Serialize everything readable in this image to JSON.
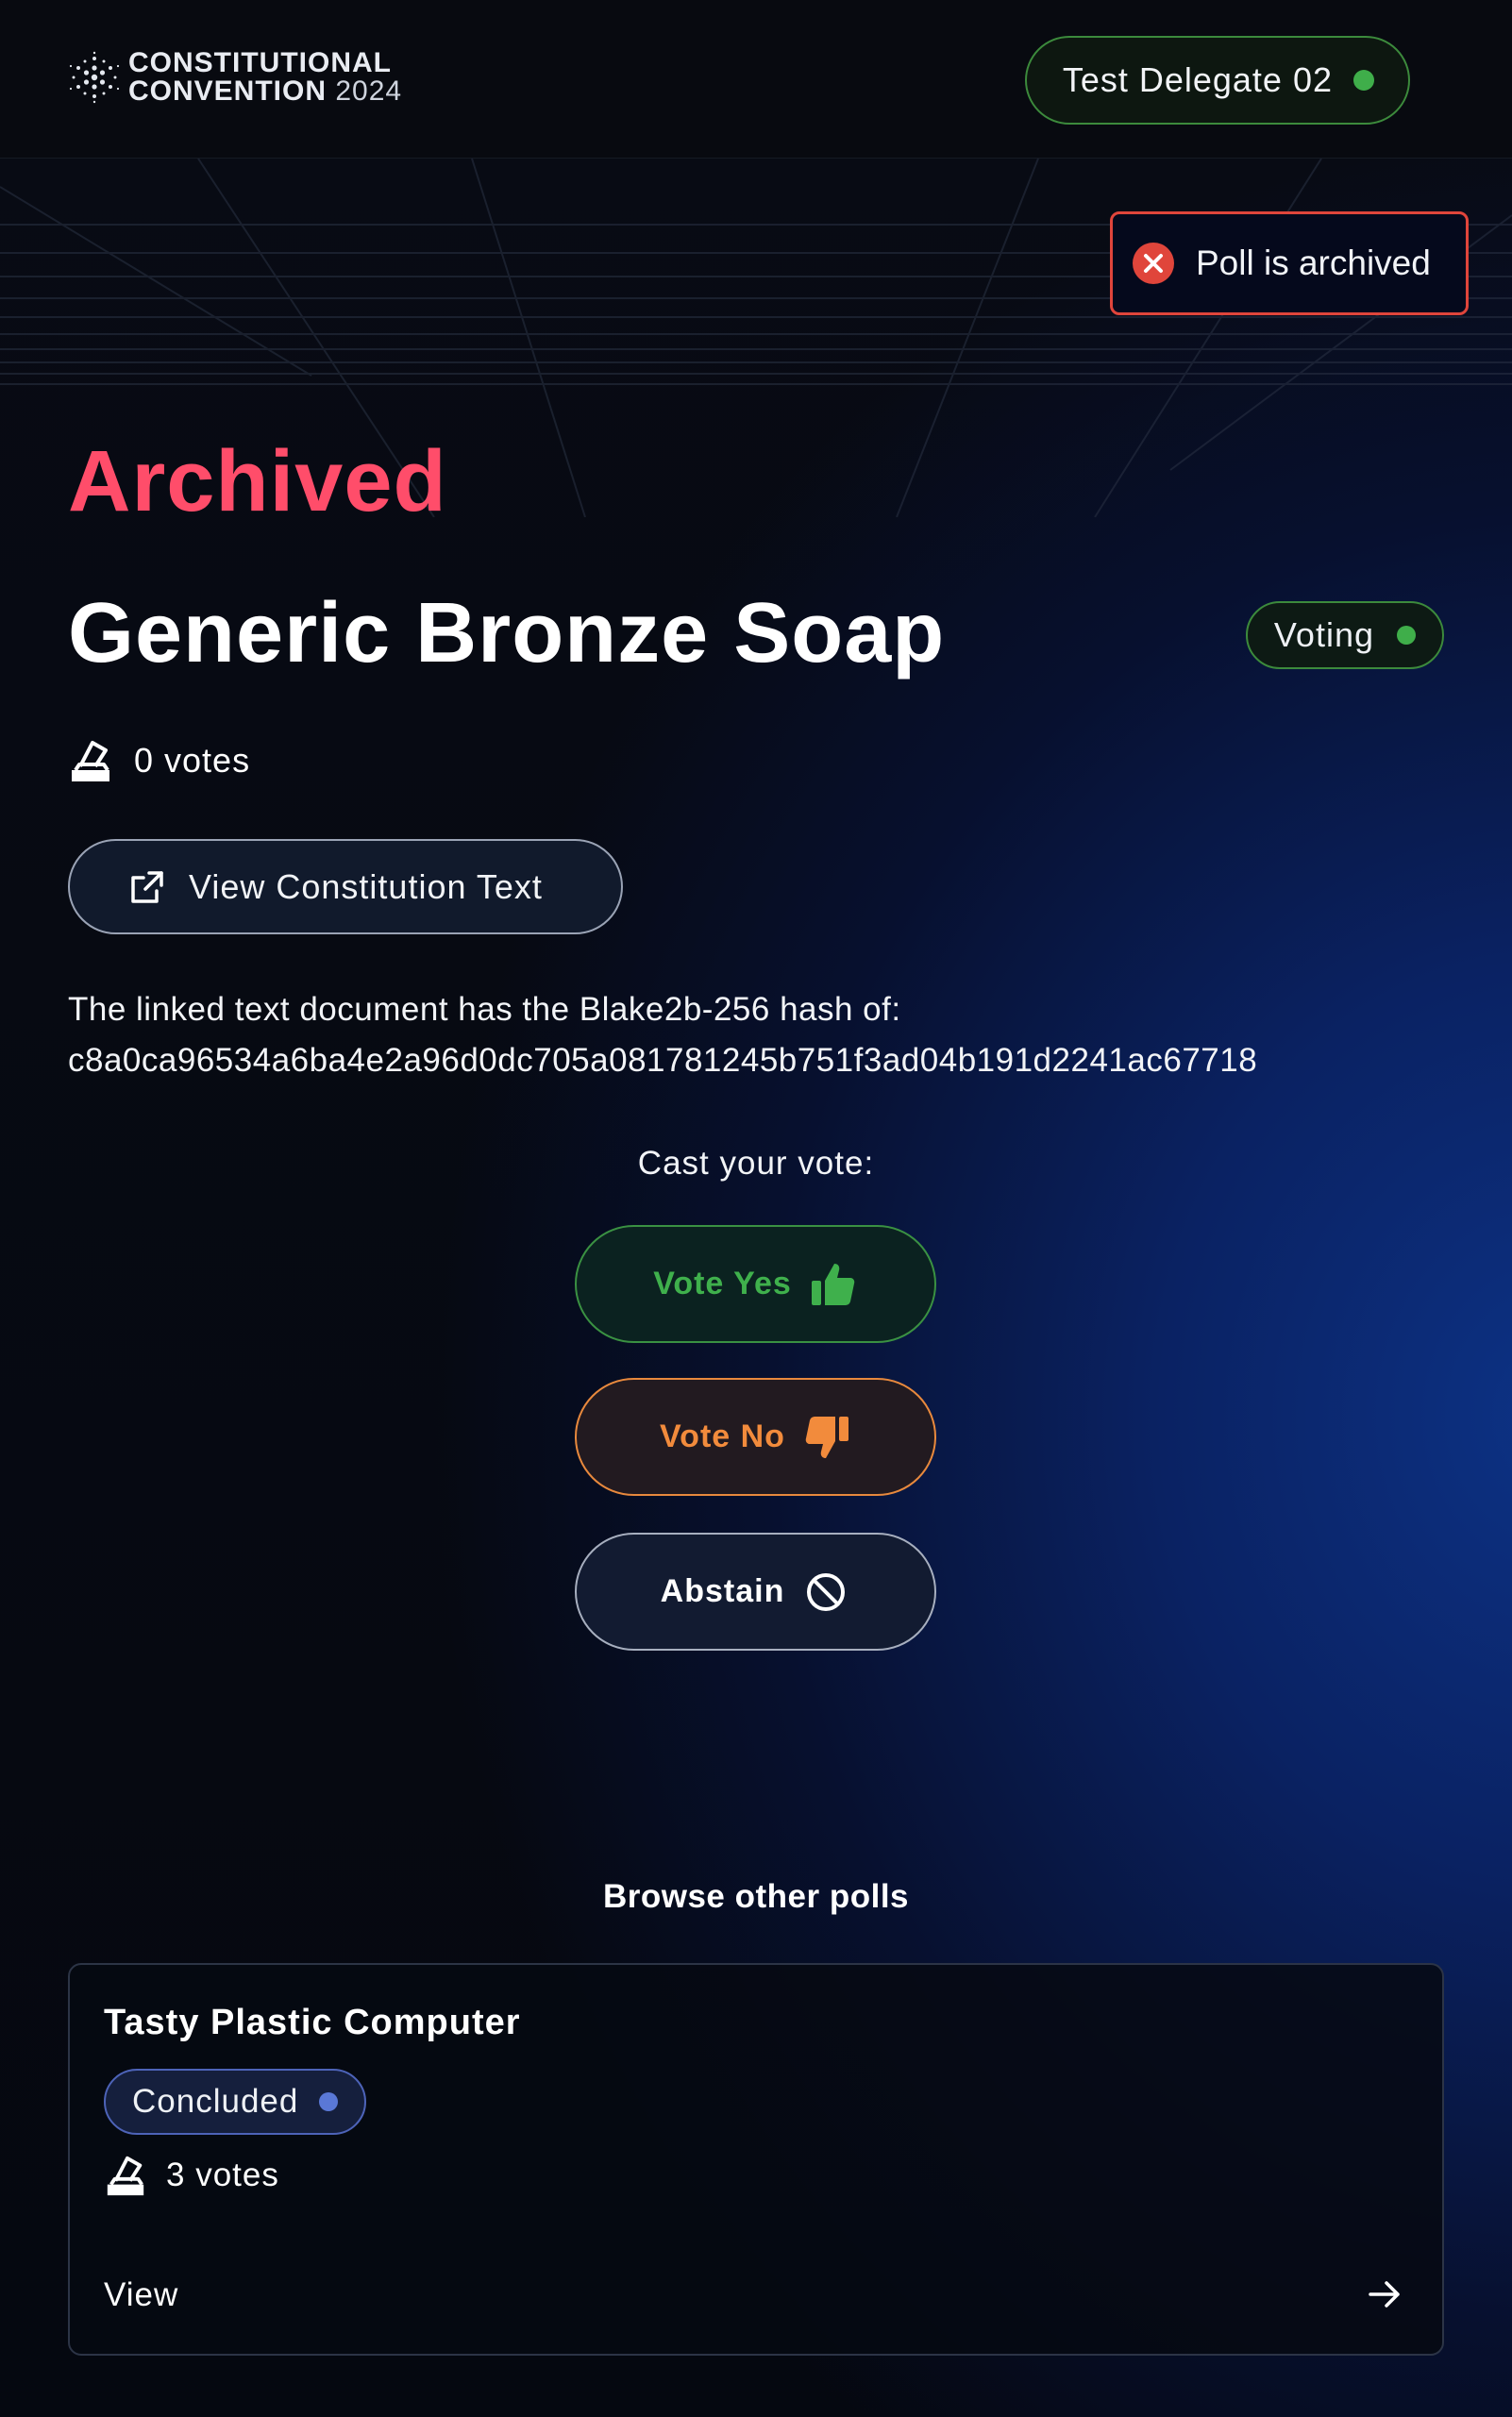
{
  "header": {
    "logo_line1": "CONSTITUTIONAL",
    "logo_line2": "CONVENTION",
    "logo_year": "2024",
    "delegate_name": "Test Delegate 02"
  },
  "toast": {
    "message": "Poll is archived"
  },
  "poll": {
    "state_label": "Archived",
    "title": "Generic Bronze Soap",
    "status": "Voting",
    "votes": "0 votes",
    "view_button": "View Constitution Text",
    "hash_intro": "The linked text document has the Blake2b-256 hash of:",
    "hash": "c8a0ca96534a6ba4e2a96d0dc705a081781245b751f3ad04b191d2241ac67718"
  },
  "voting": {
    "prompt": "Cast your vote:",
    "yes_label": "Vote Yes",
    "no_label": "Vote No",
    "abstain_label": "Abstain"
  },
  "browse": {
    "heading": "Browse other polls",
    "polls": [
      {
        "title": "Tasty Plastic Computer",
        "status": "Concluded",
        "votes": "3 votes",
        "view_label": "View"
      }
    ]
  },
  "colors": {
    "archived": "#ff4d6a",
    "voting_green": "#3fae4a",
    "no_orange": "#f28b3c",
    "concluded_blue": "#5a78d6",
    "error_red": "#e0453b"
  }
}
